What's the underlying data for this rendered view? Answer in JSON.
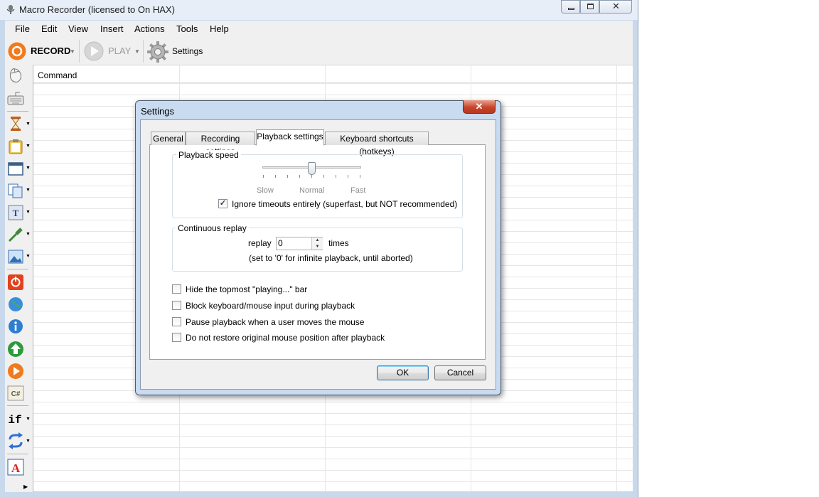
{
  "window": {
    "title": "Macro Recorder (licensed to On HAX)"
  },
  "menu": [
    "File",
    "Edit",
    "View",
    "Insert",
    "Actions",
    "Tools",
    "Help"
  ],
  "toolbar": {
    "record_label": "RECORD",
    "play_label": "PLAY",
    "settings_label": "Settings"
  },
  "tools": [
    "mouse-icon",
    "keyboard-icon",
    "hourglass-icon",
    "clipboard-icon",
    "window-icon",
    "copy-icon",
    "text-icon",
    "eyedropper-icon",
    "image-icon",
    "power-icon",
    "globe-icon",
    "info-icon",
    "upload-icon",
    "play-icon",
    "csharp-icon",
    "if-icon",
    "repeat-icon",
    "font-icon"
  ],
  "grid": {
    "columns": [
      "Command"
    ]
  },
  "dialog": {
    "title": "Settings",
    "close_glyph": "✕",
    "tabs": [
      "General",
      "Recording settings",
      "Playback settings",
      "Keyboard shortcuts (hotkeys)"
    ],
    "active_tab": "Playback settings",
    "playback_speed": {
      "label": "Playback speed",
      "slow": "Slow",
      "normal": "Normal",
      "fast": "Fast",
      "level": 0.5
    },
    "ignore_timeouts": {
      "label": "Ignore timeouts entirely (superfast, but NOT recommended)",
      "checked": true
    },
    "continuous_replay": {
      "label": "Continuous replay",
      "replay_label": "replay",
      "value": "0",
      "times_label": "times",
      "hint": "(set to '0' for infinite playback, until aborted)"
    },
    "options": [
      {
        "label": "Hide the topmost \"playing...\" bar",
        "checked": false
      },
      {
        "label": "Block keyboard/mouse input during playback",
        "checked": false
      },
      {
        "label": "Pause playback when a user moves the mouse",
        "checked": false
      },
      {
        "label": "Do not restore original mouse position after playback",
        "checked": false
      }
    ],
    "ok_label": "OK",
    "cancel_label": "Cancel"
  },
  "colors": {
    "record": "#f07a1c",
    "frame": "#c9d9ec",
    "dialog_close": "#c7452b"
  }
}
